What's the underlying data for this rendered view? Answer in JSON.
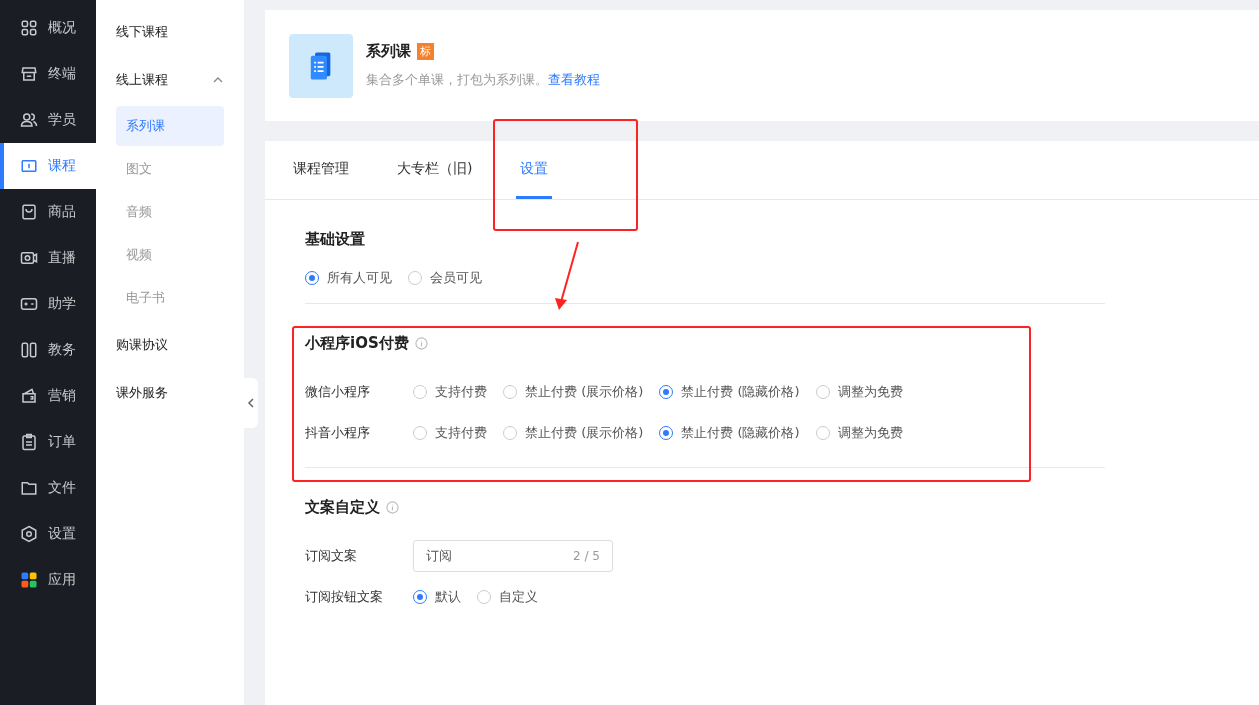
{
  "nav": [
    {
      "label": "概况",
      "selected": false
    },
    {
      "label": "终端",
      "selected": false
    },
    {
      "label": "学员",
      "selected": false
    },
    {
      "label": "课程",
      "selected": true
    },
    {
      "label": "商品",
      "selected": false
    },
    {
      "label": "直播",
      "selected": false
    },
    {
      "label": "助学",
      "selected": false
    },
    {
      "label": "教务",
      "selected": false
    },
    {
      "label": "营销",
      "selected": false
    },
    {
      "label": "订单",
      "selected": false
    },
    {
      "label": "文件",
      "selected": false
    },
    {
      "label": "设置",
      "selected": false
    },
    {
      "label": "应用",
      "selected": false
    }
  ],
  "subnav": [
    {
      "label": "线下课程"
    },
    {
      "label": "线上课程",
      "expanded": true,
      "children": [
        {
          "label": "系列课",
          "selected": true
        },
        {
          "label": "图文",
          "selected": false
        },
        {
          "label": "音频",
          "selected": false
        },
        {
          "label": "视频",
          "selected": false
        },
        {
          "label": "电子书",
          "selected": false
        }
      ]
    },
    {
      "label": "购课协议"
    },
    {
      "label": "课外服务"
    }
  ],
  "header": {
    "title": "系列课",
    "badge": "标",
    "description": "集合多个单课，打包为系列课。",
    "link": "查看教程"
  },
  "tabs": [
    {
      "label": "课程管理",
      "selected": false
    },
    {
      "label": "大专栏（旧)",
      "selected": false
    },
    {
      "label": "设置",
      "selected": true
    }
  ],
  "basic": {
    "title": "基础设置",
    "options": [
      {
        "label": "所有人可见",
        "selected": true
      },
      {
        "label": "会员可见",
        "selected": false
      }
    ]
  },
  "ios_payment": {
    "title": "小程序iOS付费",
    "rows": [
      {
        "label": "微信小程序",
        "options": [
          {
            "label": "支持付费",
            "selected": false
          },
          {
            "label": "禁止付费 (展示价格)",
            "selected": false
          },
          {
            "label": "禁止付费 (隐藏价格)",
            "selected": true
          },
          {
            "label": "调整为免费",
            "selected": false
          }
        ]
      },
      {
        "label": "抖音小程序",
        "options": [
          {
            "label": "支持付费",
            "selected": false
          },
          {
            "label": "禁止付费 (展示价格)",
            "selected": false
          },
          {
            "label": "禁止付费 (隐藏价格)",
            "selected": true
          },
          {
            "label": "调整为免费",
            "selected": false
          }
        ]
      }
    ]
  },
  "copy": {
    "title": "文案自定义",
    "field": {
      "label": "订阅文案",
      "value": "订阅",
      "count": "2 / 5"
    },
    "button_copy": {
      "label": "订阅按钮文案",
      "options": [
        {
          "label": "默认",
          "selected": true
        },
        {
          "label": "自定义",
          "selected": false
        }
      ]
    }
  }
}
